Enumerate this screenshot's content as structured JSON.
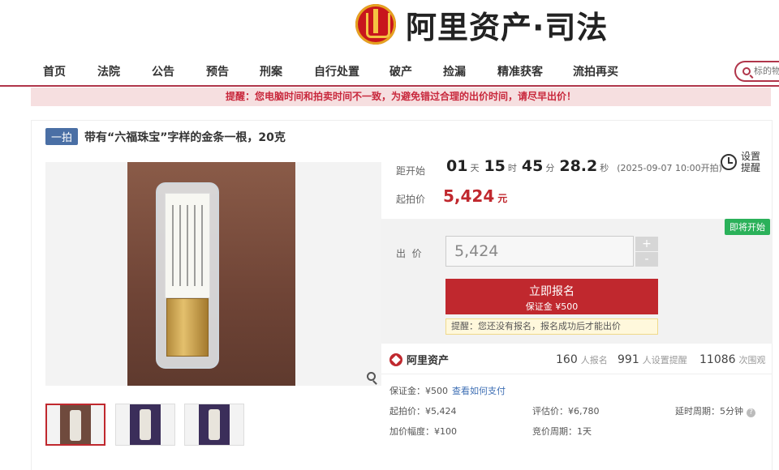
{
  "header": {
    "logo_text": "阿里资产·司法"
  },
  "nav": [
    "首页",
    "法院",
    "公告",
    "预告",
    "刑案",
    "自行处置",
    "破产",
    "捡漏",
    "精准获客",
    "流拍再买"
  ],
  "search": {
    "placeholder": "标的物"
  },
  "notice": "提醒：您电脑时间和拍卖时间不一致，为避免错过合理的出价时间，请尽早出价！",
  "item": {
    "badge": "一拍",
    "title": "带有“六福珠宝”字样的金条一根，20克"
  },
  "countdown": {
    "label": "距开始",
    "days": "01",
    "days_unit": "天",
    "hours": "15",
    "hours_unit": "时",
    "minutes": "45",
    "minutes_unit": "分",
    "seconds": "28.2",
    "seconds_unit": "秒",
    "start_time": "(2025-09-07 10:00开拍)"
  },
  "start_price": {
    "label": "起拍价",
    "value": "5,424",
    "unit": "元"
  },
  "reminder": {
    "label": "设置提醒"
  },
  "status_badge": "即将开始",
  "bid": {
    "label": "出  价",
    "value": "5,424",
    "plus": "+",
    "minus": "-",
    "signup_label": "立即报名",
    "deposit_label": "保证金 ¥500",
    "tip": "提醒：您还没有报名，报名成功后才能出价"
  },
  "stats": {
    "brand": "阿里资产",
    "signups": "160",
    "signups_unit": "人报名",
    "reminders": "991",
    "reminders_unit": "人设置提醒",
    "views": "11086",
    "views_unit": "次围观"
  },
  "details": {
    "deposit": "保证金：¥500",
    "how_to_pay": "查看如何支付",
    "start_price": "起拍价：¥5,424",
    "assessed": "评估价：¥6,780",
    "delay": "延时周期：5分钟",
    "increment": "加价幅度：¥100",
    "cycle": "竞价周期：1天"
  },
  "icons": [
    "court-emblem-icon",
    "search-icon",
    "zoom-icon",
    "clock-icon",
    "alibaba-icon",
    "help-icon"
  ]
}
